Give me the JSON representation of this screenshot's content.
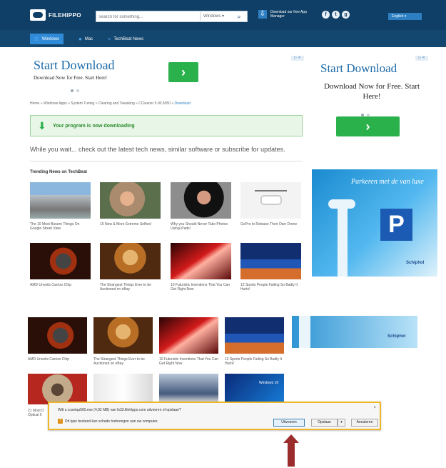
{
  "header": {
    "logo_text": "FILEHIPPO",
    "search_placeholder": "Search for something...",
    "search_os": "Windows",
    "app_manager": "Download our free App Manager",
    "language": "English"
  },
  "nav": {
    "items": [
      {
        "label": "Windows"
      },
      {
        "label": "Mac"
      },
      {
        "label": "TechBeat News"
      }
    ]
  },
  "ads": {
    "top_title": "Start Download",
    "top_sub": "Download Now for Free. Start Here!",
    "right_title": "Start Download",
    "right_sub": "Download Now for Free. Start Here!",
    "button_icon": "›",
    "choices_label": "▷ ✕",
    "right_image_text": "Parkeren met de van luxe",
    "right_image_brand": "Schiphol"
  },
  "breadcrumb": {
    "path": "Home » Windows Apps » System Tuning » Clearing and Tweaking » CCleaner 5.00.5050 » ",
    "current": "Download"
  },
  "download_status": "Your program is now downloading",
  "wait_message": "While you wait... check out the latest tech news, similar software or subscribe for updates.",
  "trending_title": "Trending News on TechBeat",
  "trending_items": [
    {
      "caption": "The 10 Most Bizarre Things On Google Street View"
    },
    {
      "caption": "16 New & More Extreme Selfies!"
    },
    {
      "caption": "Why you Should Never Take Photos Using iPads!"
    },
    {
      "caption": "GoPro to Release Their Own Drone"
    },
    {
      "caption": "AMD Unveils Carrizo Chip"
    },
    {
      "caption": "The Strangest Things Ever to be Auctioned on eBay"
    },
    {
      "caption": "10 Futuristic Inventions That You Can Get Right Now"
    },
    {
      "caption": "12 Sports People Failing So Badly It Hurts!"
    }
  ],
  "lower_items": [
    {
      "caption": "AMD Unveils Carrizo Chip"
    },
    {
      "caption": "The Strangest Things Ever to be Auctioned on eBay"
    },
    {
      "caption": "10 Futuristic Inventions That You Can Get Right Now"
    },
    {
      "caption": "12 Sports People Failing So Badly It Hurts!"
    }
  ],
  "bottom_items": [
    {
      "caption": "21 Most D Optical Il"
    },
    {
      "caption": ""
    },
    {
      "caption": ""
    },
    {
      "caption": "Windows 10"
    }
  ],
  "download_bar": {
    "message": "Wilt u ccsetup500.exe (4,92 MB) van fs33.filehippo.com uitvoeren of opslaan?",
    "warning": "Dit type bestand kan schade toebrengen aan uw computer.",
    "buttons": [
      "Uitvoeren",
      "Opslaan",
      "Annuleren"
    ],
    "close": "×"
  },
  "colors": {
    "header": "#0f3f66",
    "nav": "#13476f",
    "accent": "#2d7fc1",
    "success": "#2bb14c",
    "warning_border": "#eeb72a",
    "arrow": "#9b2c2c"
  }
}
